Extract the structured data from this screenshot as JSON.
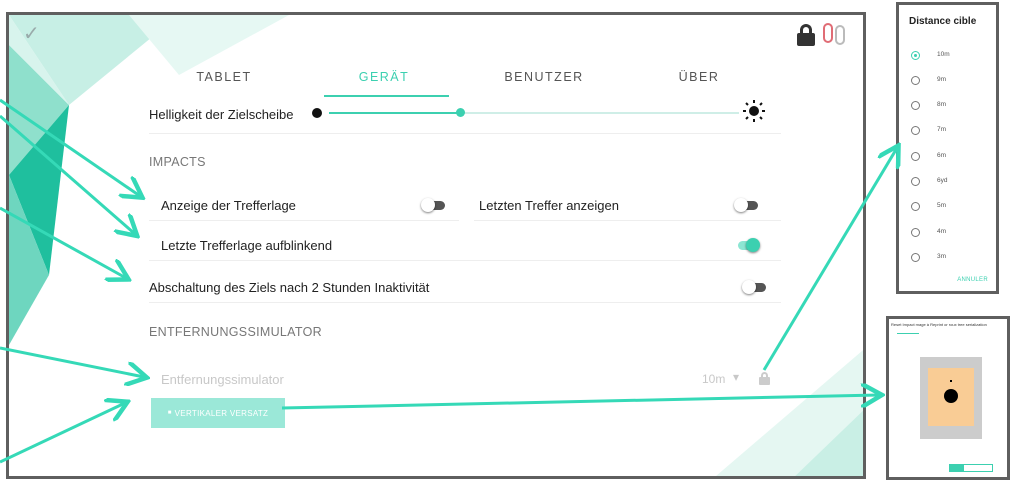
{
  "colors": {
    "accent": "#3cd0b0",
    "frame": "#5f5f5f",
    "arrow": "#35d9b7"
  },
  "header": {
    "check_icon": "✓"
  },
  "tabs": [
    {
      "label": "TABLET",
      "active": false
    },
    {
      "label": "GERÄT",
      "active": true
    },
    {
      "label": "BENUTZER",
      "active": false
    },
    {
      "label": "ÜBER",
      "active": false
    }
  ],
  "brightness": {
    "label": "Helligkeit der Zielscheibe",
    "level_percent": 32
  },
  "impacts": {
    "section_label": "IMPACTS",
    "show_impact_position": {
      "label": "Anzeige der Trefferlage",
      "on": false
    },
    "show_last_hit": {
      "label": "Letzten Treffer anzeigen",
      "on": false
    },
    "blink_last_impact": {
      "label": "Letzte Trefferlage aufblinkend",
      "on": true
    },
    "auto_shutdown": {
      "label": "Abschaltung des Ziels nach 2 Stunden Inaktivität",
      "on": false
    }
  },
  "simulator": {
    "section_label": "ENTFERNUNGSSIMULATOR",
    "label": "Entfernungssimulator",
    "value": "10m",
    "vertical_offset_button": "VERTIKALER VERSATZ"
  },
  "distance_dialog": {
    "title": "Distance cible",
    "options": [
      "10m",
      "9m",
      "8m",
      "7m",
      "6m",
      "6yd",
      "5m",
      "4m",
      "3m"
    ],
    "selected": "10m",
    "cancel_label": "ANNULER"
  },
  "reset_dialog": {
    "header": "Reset Impact mage à Reprint or roux tree serialization"
  }
}
